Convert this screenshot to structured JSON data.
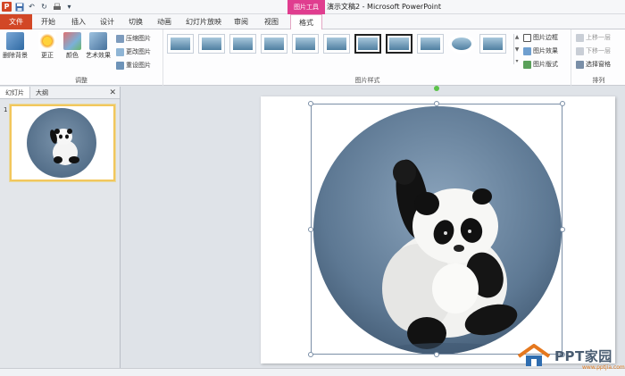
{
  "window": {
    "context_tool": "图片工具",
    "title": "演示文稿2 - Microsoft PowerPoint"
  },
  "tabs": [
    {
      "label": "文件"
    },
    {
      "label": "开始"
    },
    {
      "label": "插入"
    },
    {
      "label": "设计"
    },
    {
      "label": "切换"
    },
    {
      "label": "动画"
    },
    {
      "label": "幻灯片放映"
    },
    {
      "label": "审阅"
    },
    {
      "label": "视图"
    },
    {
      "label": "格式"
    }
  ],
  "ribbon": {
    "adjust": {
      "label": "调整",
      "remove_bg": "删除背景",
      "corrections": "更正",
      "color": "颜色",
      "artistic": "艺术效果",
      "compress": "压缩图片",
      "change": "更改图片",
      "reset": "重设图片"
    },
    "styles": {
      "label": "图片样式",
      "border": "图片边框",
      "effects": "图片效果",
      "layout": "图片版式"
    },
    "arrange": {
      "label": "排列",
      "bring_forward": "上移一层",
      "send_backward": "下移一层",
      "selection_pane": "选择窗格"
    }
  },
  "left_pane": {
    "tab_slides": "幻灯片",
    "tab_outline": "大纲",
    "slide_number": "1"
  },
  "watermark": {
    "text": "PPT家园",
    "sub": "www.pptjia.com"
  },
  "colors": {
    "file_tab": "#d24726",
    "context_pink": "#e03d8f",
    "slide_highlight": "#f2c75c"
  }
}
